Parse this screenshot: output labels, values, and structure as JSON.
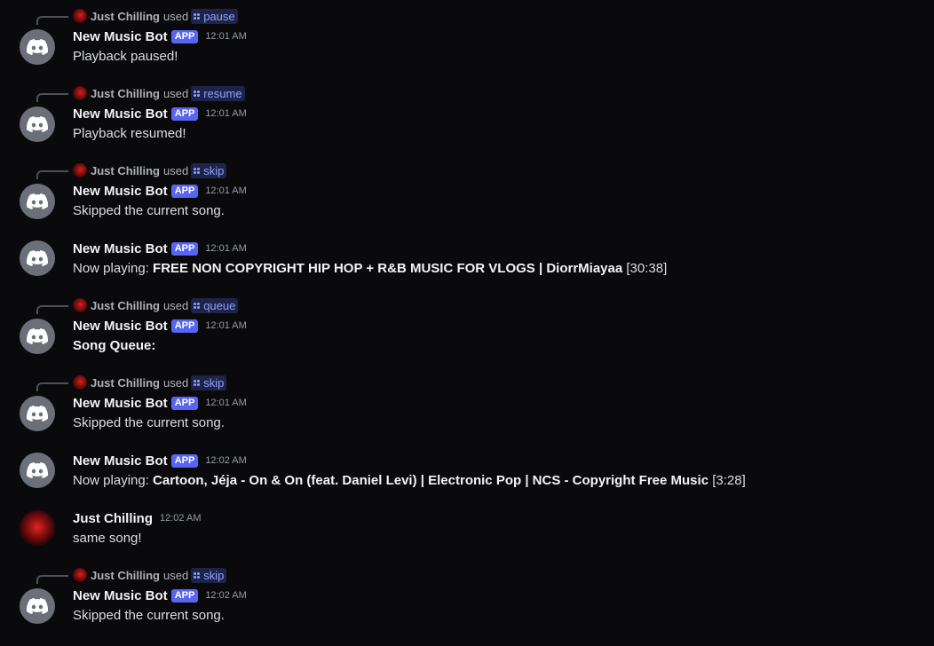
{
  "messages": [
    {
      "reply": {
        "user": "Just Chilling",
        "used": "used",
        "command": "pause"
      },
      "author": "New Music Bot",
      "badge": "APP",
      "time": "12:01 AM",
      "text": "Playback paused!"
    },
    {
      "reply": {
        "user": "Just Chilling",
        "used": "used",
        "command": "resume"
      },
      "author": "New Music Bot",
      "badge": "APP",
      "time": "12:01 AM",
      "text": "Playback resumed!"
    },
    {
      "reply": {
        "user": "Just Chilling",
        "used": "used",
        "command": "skip"
      },
      "author": "New Music Bot",
      "badge": "APP",
      "time": "12:01 AM",
      "text": "Skipped the current song."
    },
    {
      "author": "New Music Bot",
      "badge": "APP",
      "time": "12:01 AM",
      "prefix": "Now playing: ",
      "bold": "FREE NON COPYRIGHT HIP HOP + R&B MUSIC FOR VLOGS | DiorrMiayaa",
      "suffix": " [30:38]"
    },
    {
      "reply": {
        "user": "Just Chilling",
        "used": "used",
        "command": "queue"
      },
      "author": "New Music Bot",
      "badge": "APP",
      "time": "12:01 AM",
      "bold": "Song Queue:"
    },
    {
      "reply": {
        "user": "Just Chilling",
        "used": "used",
        "command": "skip"
      },
      "author": "New Music Bot",
      "badge": "APP",
      "time": "12:01 AM",
      "text": "Skipped the current song."
    },
    {
      "author": "New Music Bot",
      "badge": "APP",
      "time": "12:02 AM",
      "prefix": "Now playing: ",
      "bold": "Cartoon, Jéja - On & On (feat. Daniel Levi) | Electronic Pop | NCS - Copyright Free Music",
      "suffix": " [3:28]"
    },
    {
      "author": "Just Chilling",
      "time": "12:02 AM",
      "text": "same song!"
    },
    {
      "reply": {
        "user": "Just Chilling",
        "used": "used",
        "command": "skip"
      },
      "author": "New Music Bot",
      "badge": "APP",
      "time": "12:02 AM",
      "text": "Skipped the current song."
    }
  ],
  "colors": {
    "background": "#0a0a0d",
    "app_badge": "#5865f2",
    "command_pill_bg": "#1e2449",
    "command_pill_text": "#8ea1ff",
    "bot_avatar": "#6b6f78"
  },
  "icons": {
    "bot_avatar": "discord-logo-icon",
    "command": "slash-command-icon"
  }
}
